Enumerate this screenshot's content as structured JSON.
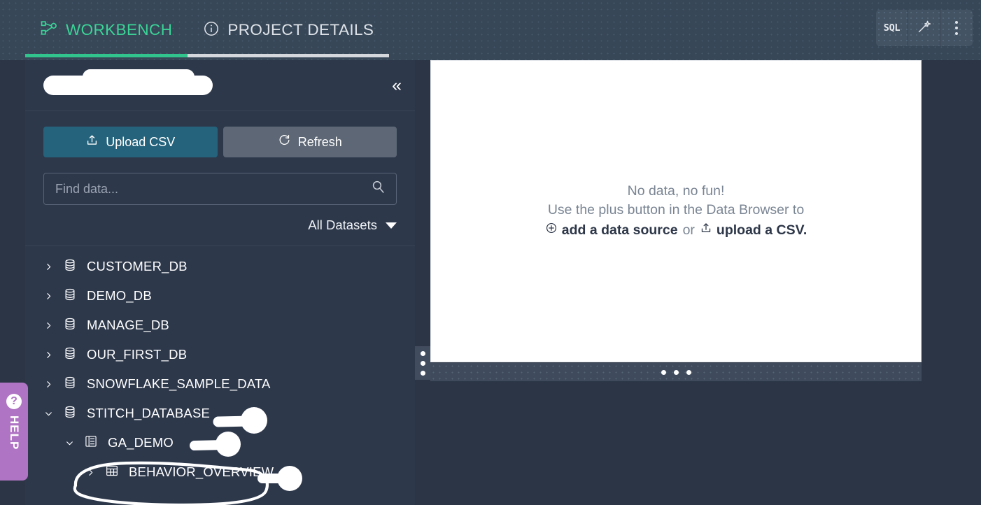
{
  "header": {
    "tabs": [
      {
        "label": "WORKBENCH",
        "icon": "workflow-nodes-icon",
        "active": true
      },
      {
        "label": "PROJECT DETAILS",
        "icon": "info-circle-icon",
        "active": false
      }
    ],
    "actions": [
      {
        "label": "SQL",
        "icon": "sql-text-icon"
      },
      {
        "label": "",
        "icon": "magic-wand-icon"
      },
      {
        "label": "",
        "icon": "kebab-menu-icon"
      }
    ]
  },
  "sidebar": {
    "title_redacted": "",
    "collapse_icon": "double-chevron-left-icon",
    "buttons": {
      "upload_label": "Upload CSV",
      "upload_icon": "upload-icon",
      "refresh_label": "Refresh",
      "refresh_icon": "refresh-icon"
    },
    "search": {
      "placeholder": "Find data...",
      "value": "",
      "icon": "search-icon"
    },
    "filter": {
      "label": "All Datasets",
      "icon": "chevron-down-icon"
    },
    "tree": [
      {
        "label": "CUSTOMER_DB",
        "icon": "database-icon",
        "level": 1,
        "expanded": false
      },
      {
        "label": "DEMO_DB",
        "icon": "database-icon",
        "level": 1,
        "expanded": false
      },
      {
        "label": "MANAGE_DB",
        "icon": "database-icon",
        "level": 1,
        "expanded": false
      },
      {
        "label": "OUR_FIRST_DB",
        "icon": "database-icon",
        "level": 1,
        "expanded": false
      },
      {
        "label": "SNOWFLAKE_SAMPLE_DATA",
        "icon": "database-icon",
        "level": 1,
        "expanded": false
      },
      {
        "label": "STITCH_DATABASE",
        "icon": "database-icon",
        "level": 1,
        "expanded": true
      },
      {
        "label": "GA_DEMO",
        "icon": "schema-icon",
        "level": 2,
        "expanded": true
      },
      {
        "label": "BEHAVIOR_OVERVIEW",
        "icon": "table-icon",
        "level": 3,
        "expanded": false
      }
    ]
  },
  "main": {
    "empty_state": {
      "line1": "No data, no fun!",
      "line2": "Use the plus button in the Data Browser to",
      "add_source_label": "add a data source",
      "add_source_icon": "plus-circle-icon",
      "or_label": "or",
      "upload_csv_label": "upload a CSV.",
      "upload_csv_icon": "upload-icon"
    },
    "vertical_splitter_icon": "drag-handle-dots-icon",
    "horizontal_splitter_icon": "drag-handle-dots-icon"
  },
  "help": {
    "label": "HELP",
    "icon": "question-mark-icon"
  },
  "colors": {
    "accent_green": "#31c48d",
    "topbar_bg": "#374758",
    "sidebar_bg": "#2d384b",
    "upload_teal": "#25637c",
    "refresh_gray": "#5d6775",
    "help_purple": "#b074c4",
    "annotation_white": "#ffffff"
  }
}
